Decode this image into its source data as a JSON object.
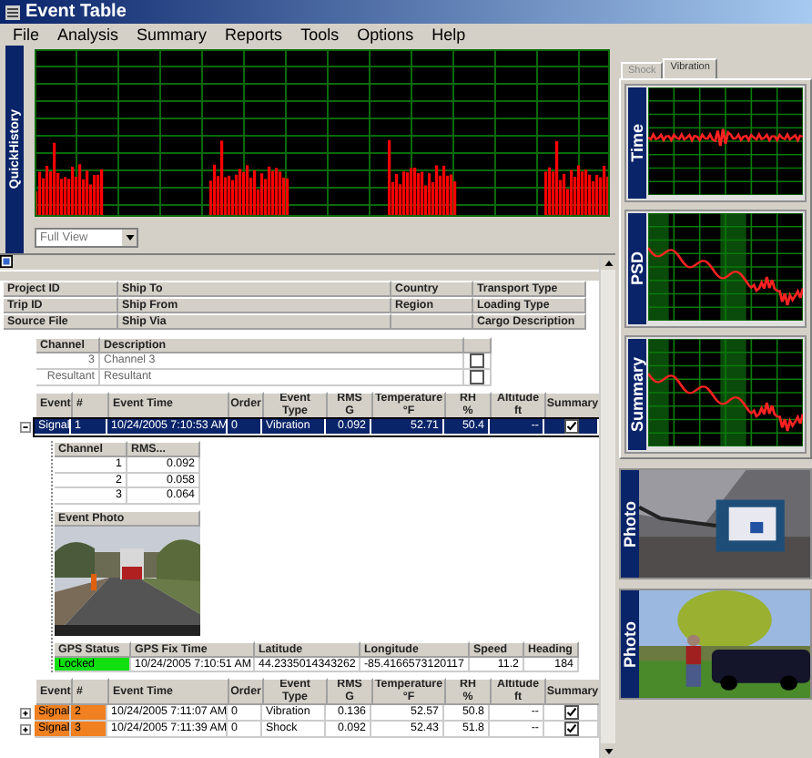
{
  "window": {
    "title": "Event Table"
  },
  "menu": [
    "File",
    "Analysis",
    "Summary",
    "Reports",
    "Tools",
    "Options",
    "Help"
  ],
  "quick_history": {
    "label": "QuickHistory",
    "view_select": {
      "value": "Full View"
    }
  },
  "header_fields": [
    {
      "col_1": "Project ID",
      "col_2": "Ship To",
      "col_3": "Country",
      "col_4": "Transport Type"
    },
    {
      "col_1": "Trip ID",
      "col_2": "Ship From",
      "col_3": "Region",
      "col_4": "Loading Type"
    },
    {
      "col_1": "Source File",
      "col_2": "Ship Via",
      "col_4": "Cargo Description"
    }
  ],
  "channel_table": {
    "columns": [
      "Channel",
      "Description"
    ],
    "rows": [
      {
        "channel": "3",
        "description": "Channel 3",
        "checked": false
      },
      {
        "channel": "Resultant",
        "description": "Resultant",
        "checked": false
      }
    ]
  },
  "event_table_1": {
    "columns": [
      "Event",
      "#",
      "Event Time",
      "Order",
      "Event Type",
      "RMS\nG",
      "Temperature\n°F",
      "RH\n%",
      "Altitude\nft",
      "Summary"
    ],
    "rows": [
      {
        "event": "Signal",
        "number": "1",
        "time": "10/24/2005 7:10:53 AM",
        "order": "0",
        "type": "Vibration",
        "rms": "0.092",
        "temperature": "52.71",
        "rh": "50.4",
        "altitude": "--",
        "summary": true,
        "selected": true,
        "expanded": true
      }
    ]
  },
  "event_detail": {
    "rms_table": {
      "columns": [
        "Channel",
        "RMS..."
      ],
      "rows": [
        {
          "channel": "1",
          "rms": "0.092"
        },
        {
          "channel": "2",
          "rms": "0.058"
        },
        {
          "channel": "3",
          "rms": "0.064"
        }
      ]
    },
    "photo_title": "Event Photo",
    "gps_table": {
      "columns": [
        "GPS Status",
        "GPS Fix Time",
        "Latitude",
        "Longitude",
        "Speed",
        "Heading"
      ],
      "row": {
        "status": "Locked",
        "locked": true,
        "fix_time": "10/24/2005 7:10:51 AM",
        "latitude": "44.2335014343262",
        "longitude": "-85.4166573120117",
        "speed": "11.2",
        "heading": "184"
      }
    }
  },
  "event_table_2": {
    "columns": [
      "Event",
      "#",
      "Event Time",
      "Order",
      "Event Type",
      "RMS\nG",
      "Temperature\n°F",
      "RH\n%",
      "Altitude\nft",
      "Summary"
    ],
    "rows": [
      {
        "event": "Signal",
        "number": "2",
        "time": "10/24/2005 7:11:07 AM",
        "order": "0",
        "type": "Vibration",
        "rms": "0.136",
        "temperature": "52.57",
        "rh": "50.8",
        "altitude": "--",
        "summary": true,
        "selected": false,
        "expanded": false
      },
      {
        "event": "Signal",
        "number": "3",
        "time": "10/24/2005 7:11:39 AM",
        "order": "0",
        "type": "Shock",
        "rms": "0.092",
        "temperature": "52.43",
        "rh": "51.8",
        "altitude": "--",
        "summary": true,
        "selected": false,
        "expanded": false
      }
    ]
  },
  "side_tabs": [
    {
      "label": "Shock",
      "selected": false
    },
    {
      "label": "Vibration",
      "selected": true
    }
  ],
  "plots": [
    {
      "label": "Time",
      "kind": "time"
    },
    {
      "label": "PSD",
      "kind": "psd"
    },
    {
      "label": "Summary",
      "kind": "psd"
    }
  ],
  "photos": [
    {
      "label": "Photo",
      "kind": "picture"
    },
    {
      "label": "Photo",
      "kind": "picture"
    }
  ]
}
